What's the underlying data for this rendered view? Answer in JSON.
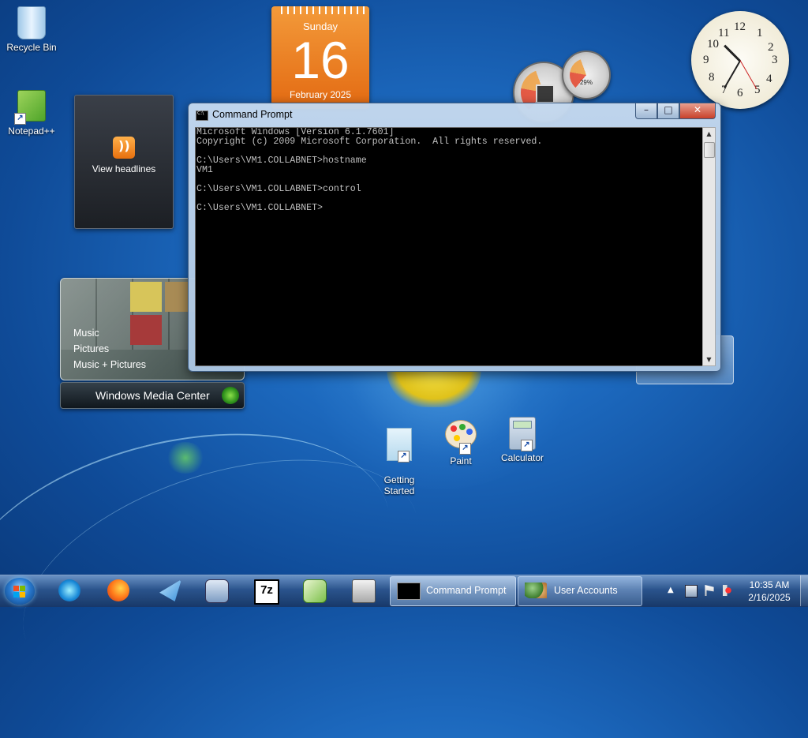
{
  "desktop_icons": {
    "recycle_bin": "Recycle Bin",
    "notepadpp": "Notepad++",
    "getting_started": "Getting\nStarted",
    "paint": "Paint",
    "calculator": "Calculator"
  },
  "calendar_gadget": {
    "weekday": "Sunday",
    "day": "16",
    "month_year": "February 2025"
  },
  "cpu_meter": {
    "memory_percent": "29%"
  },
  "clock_gadget": {
    "numerals": [
      "12",
      "1",
      "2",
      "3",
      "4",
      "5",
      "6",
      "7",
      "8",
      "9",
      "10",
      "11"
    ]
  },
  "feed_gadget": {
    "label": "View headlines"
  },
  "media_center_gadget": {
    "items": [
      "Music",
      "Pictures",
      "Music + Pictures"
    ],
    "title": "Windows Media Center"
  },
  "command_prompt": {
    "title": "Command Prompt",
    "controls": {
      "minimize": "–",
      "maximize": "□",
      "close": "✕"
    },
    "lines": [
      "Microsoft Windows [Version 6.1.7601]",
      "Copyright (c) 2009 Microsoft Corporation.  All rights reserved.",
      "",
      "C:\\Users\\VM1.COLLABNET>hostname",
      "VM1",
      "",
      "C:\\Users\\VM1.COLLABNET>control",
      "",
      "C:\\Users\\VM1.COLLABNET>"
    ]
  },
  "taskbar": {
    "pinned": [
      "Internet Explorer",
      "Firefox",
      "Mail",
      "Network",
      "7-Zip",
      "Notepad++",
      "Printer"
    ],
    "tasks": [
      {
        "label": "Command Prompt"
      },
      {
        "label": "User Accounts"
      }
    ],
    "clock": {
      "time": "10:35 AM",
      "date": "2/16/2025"
    }
  },
  "colors": {
    "accent": "#1c68bd",
    "taskbar": "#1f4a86",
    "calendar": "#e36a12"
  }
}
